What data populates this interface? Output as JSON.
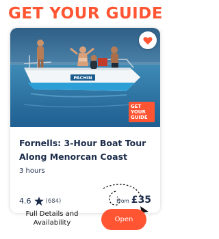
{
  "brand": {
    "logo_text": "GET YOUR GUIDE",
    "color": "#ff5533"
  },
  "card": {
    "image_alt": "Group of people on a boat's bow with a woman about to jump into the sea",
    "boat_name": "PACHIN",
    "badge": {
      "line1": "GET",
      "line2": "YOUR",
      "line3": "GUIDE"
    },
    "favorite_icon": "heart-icon",
    "title": "Fornells: 3-Hour Boat Tour Along Menorcan Coast",
    "duration": "3 hours",
    "rating": {
      "score": "4.6",
      "icon": "star-icon",
      "count": "(684)"
    },
    "price": {
      "prefix": "From",
      "amount": "£35"
    }
  },
  "footer": {
    "details_text": "Full Details and Availability",
    "open_label": "Open"
  },
  "colors": {
    "accent": "#ff5533",
    "text": "#1a2b49"
  }
}
